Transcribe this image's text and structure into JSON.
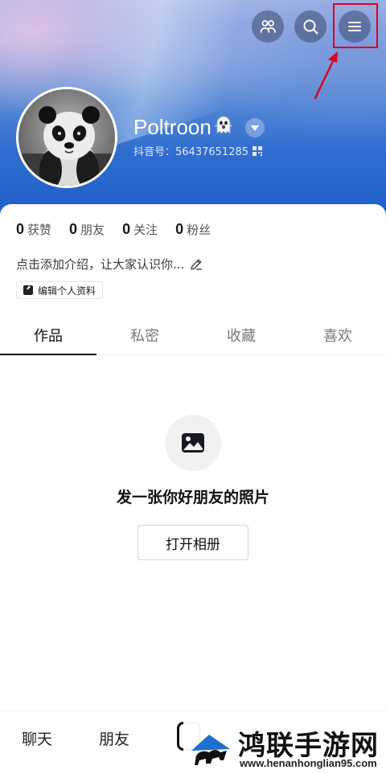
{
  "header": {
    "username": "Poltroon",
    "username_emoji": "ghost-emoji",
    "douyin_id": "抖音号：56437651285",
    "icons": [
      "friends-icon",
      "search-icon",
      "menu-icon"
    ],
    "accent_color": "#2f6dcf"
  },
  "stats": [
    {
      "num": "0",
      "label": "获赞"
    },
    {
      "num": "0",
      "label": "朋友"
    },
    {
      "num": "0",
      "label": "关注"
    },
    {
      "num": "0",
      "label": "粉丝"
    }
  ],
  "bio": "点击添加介绍，让大家认识你...",
  "edit_profile": "编辑个人资料",
  "tabs": [
    {
      "label": "作品",
      "active": true
    },
    {
      "label": "私密",
      "active": false
    },
    {
      "label": "收藏",
      "active": false
    },
    {
      "label": "喜欢",
      "active": false
    }
  ],
  "empty_state": {
    "title": "发一张你好朋友的照片",
    "button": "打开相册"
  },
  "bottom_nav": [
    {
      "label": "聊天"
    },
    {
      "label": "朋友"
    }
  ],
  "watermark": {
    "title": "鸿联手游网",
    "url": "www.henanhonglian95.com"
  }
}
